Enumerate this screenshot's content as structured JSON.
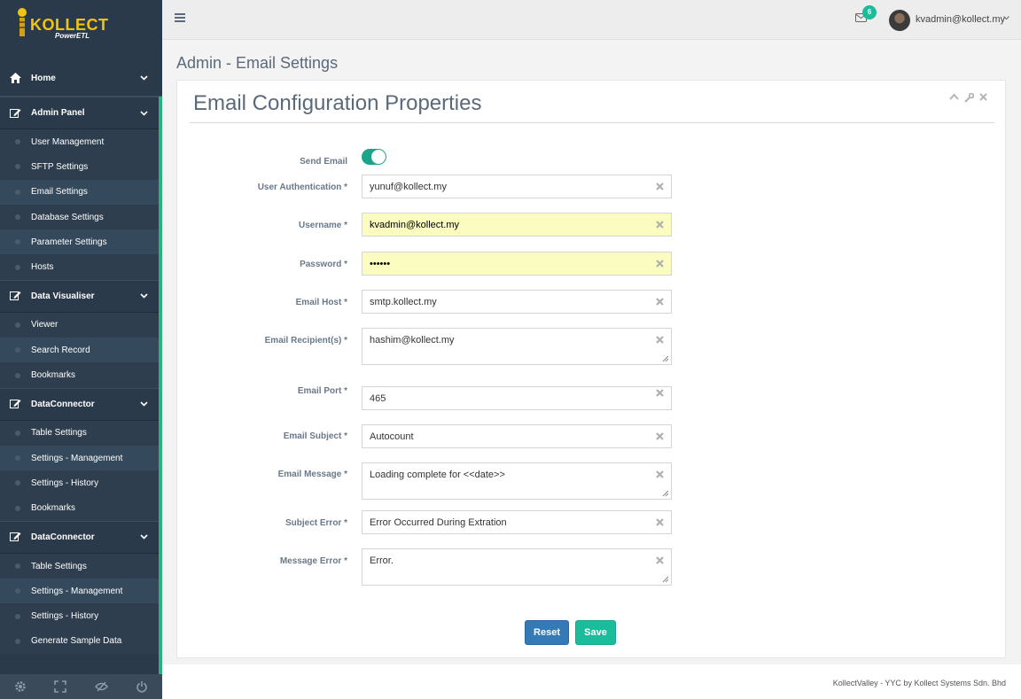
{
  "brand": {
    "name": "KOLLECT",
    "tagline": "PowerETL"
  },
  "sidebar": {
    "home": "Home",
    "groups": [
      {
        "label": "Admin Panel",
        "items": [
          "User Management",
          "SFTP Settings",
          "Email Settings",
          "Database Settings",
          "Parameter Settings",
          "Hosts"
        ],
        "active": "Email Settings"
      },
      {
        "label": "Data Visualiser",
        "items": [
          "Viewer",
          "Search Record",
          "Bookmarks"
        ]
      },
      {
        "label": "DataConnector",
        "items": [
          "Table Settings",
          "Settings - Management",
          "Settings - History",
          "Bookmarks"
        ]
      },
      {
        "label": "DataConnector",
        "items": [
          "Table Settings",
          "Settings - Management",
          "Settings - History",
          "Generate Sample Data"
        ]
      }
    ],
    "footer_icons": [
      "gear-icon",
      "fullscreen-icon",
      "eye-slash-icon",
      "power-icon"
    ]
  },
  "topbar": {
    "notification_count": "6",
    "user": "kvadmin@kollect.my"
  },
  "page": {
    "title": "Admin - Email Settings"
  },
  "panel": {
    "title": "Email Configuration Properties",
    "fields": {
      "send_email": {
        "label": "Send Email",
        "on": true
      },
      "user_auth": {
        "label": "User Authentication *",
        "value": "yunuf@kollect.my"
      },
      "username": {
        "label": "Username *",
        "value": "kvadmin@kollect.my"
      },
      "password": {
        "label": "Password *",
        "value": "••••••"
      },
      "email_host": {
        "label": "Email Host *",
        "value": "smtp.kollect.my"
      },
      "recipients": {
        "label": "Email Recipient(s) *",
        "value": "hashim@kollect.my"
      },
      "port": {
        "label": "Email Port *",
        "value": "465"
      },
      "subject": {
        "label": "Email Subject *",
        "value": "Autocount"
      },
      "message": {
        "label": "Email Message *",
        "value": "Loading complete for <<date>>"
      },
      "subject_error": {
        "label": "Subject Error *",
        "value": "Error Occurred During Extration"
      },
      "message_error": {
        "label": "Message Error *",
        "value": "Error."
      }
    },
    "buttons": {
      "reset": "Reset",
      "save": "Save"
    }
  },
  "footer": "KollectValley - YYC by Kollect Systems Sdn. Bhd",
  "colors": {
    "sidebar": "#2b3a4a",
    "accent": "#1abc9c",
    "primary": "#337ab7",
    "autofill": "#fbfcc0"
  }
}
